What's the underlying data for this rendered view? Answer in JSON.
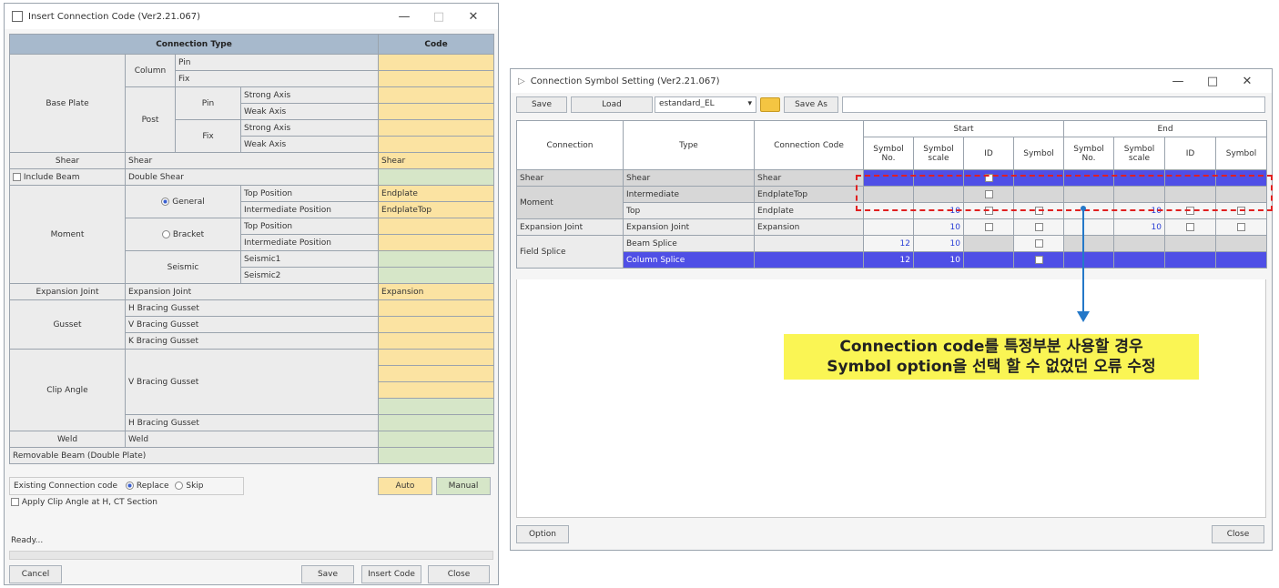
{
  "left": {
    "title": "Insert Connection Code (Ver2.21.067)",
    "win_min": "—",
    "win_max": "□",
    "win_close": "✕",
    "hdr_type": "Connection Type",
    "hdr_code": "Code",
    "base_plate": "Base Plate",
    "column": "Column",
    "post": "Post",
    "pin": "Pin",
    "fix": "Fix",
    "strong": "Strong Axis",
    "weak": "Weak Axis",
    "shear": "Shear",
    "include_beam": "Include Beam",
    "double_shear": "Double Shear",
    "code_shear": "Shear",
    "moment": "Moment",
    "general": "General",
    "bracket": "Bracket",
    "seismic": "Seismic",
    "top_pos": "Top Position",
    "inter_pos": "Intermediate Position",
    "seismic1": "Seismic1",
    "seismic2": "Seismic2",
    "code_endplate": "Endplate",
    "code_endplate_top": "EndplateTop",
    "expansion": "Expansion Joint",
    "code_expansion": "Expansion",
    "gusset": "Gusset",
    "h_gusset": "H Bracing Gusset",
    "v_gusset": "V Bracing Gusset",
    "k_gusset": "K Bracing Gusset",
    "clip": "Clip Angle",
    "weld": "Weld",
    "removable": "Removable Beam (Double Plate)",
    "existing": "Existing Connection code",
    "replace": "Replace",
    "skip": "Skip",
    "auto": "Auto",
    "manual": "Manual",
    "apply_clip": "Apply Clip Angle at H, CT Section",
    "status": "Ready...",
    "cancel": "Cancel",
    "save": "Save",
    "insert": "Insert Code",
    "close": "Close"
  },
  "right": {
    "title": "Connection Symbol Setting (Ver2.21.067)",
    "win_min": "—",
    "win_max": "□",
    "win_close": "✕",
    "save": "Save",
    "load": "Load",
    "combo": "estandard_EL",
    "save_as": "Save As",
    "col_connection": "Connection",
    "col_type": "Type",
    "col_code": "Connection Code",
    "start": "Start",
    "end": "End",
    "sym_no": "Symbol No.",
    "sym_scale": "Symbol scale",
    "id": "ID",
    "symbol": "Symbol",
    "rows": [
      {
        "connection": "Shear",
        "type": "Shear",
        "code": "Shear"
      },
      {
        "connection": "Moment",
        "type": "Intermediate",
        "code": "EndplateTop"
      },
      {
        "connection": "",
        "type": "Top",
        "code": "Endplate",
        "s_scale": "10",
        "e_scale": "10"
      },
      {
        "connection": "Expansion Joint",
        "type": "Expansion Joint",
        "code": "Expansion",
        "s_scale": "10",
        "e_scale": "10"
      },
      {
        "connection": "Field Splice",
        "type": "Beam Splice",
        "code": "",
        "s_no": "12",
        "s_scale": "10"
      },
      {
        "connection": "",
        "type": "Column Splice",
        "code": "",
        "s_no": "12",
        "s_scale": "10"
      }
    ],
    "option": "Option",
    "close": "Close"
  },
  "callout": {
    "line1": "Connection code를 특정부분 사용할 경우",
    "line2": "Symbol option을 선택 할 수 없었던 오류 수정"
  },
  "colors": {
    "header": "#a7b9cc",
    "code_yellow": "#fbe3a2",
    "code_green": "#d6e6c8",
    "selection": "#4f4fe6",
    "highlight_box": "#e02020",
    "arrow": "#2478c8",
    "callout_bg": "#faf554"
  }
}
